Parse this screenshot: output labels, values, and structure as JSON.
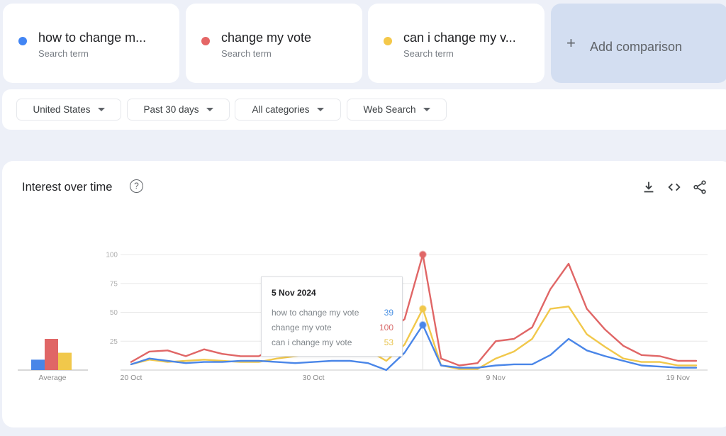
{
  "terms": [
    {
      "label": "how to change m...",
      "full": "how to change my vote",
      "sub": "Search term",
      "color": "#4285f4"
    },
    {
      "label": "change my vote",
      "full": "change my vote",
      "sub": "Search term",
      "color": "#e56666"
    },
    {
      "label": "can i change my v...",
      "full": "can i change my vote",
      "sub": "Search term",
      "color": "#f4c84a"
    }
  ],
  "add_comparison": {
    "icon": "+",
    "label": "Add comparison"
  },
  "filters": [
    {
      "label": "United States"
    },
    {
      "label": "Past 30 days"
    },
    {
      "label": "All categories"
    },
    {
      "label": "Web Search"
    }
  ],
  "panel": {
    "title": "Interest over time",
    "help_icon": "?",
    "actions": [
      "download-icon",
      "embed-code-icon",
      "share-icon"
    ]
  },
  "tooltip": {
    "date": "5 Nov 2024",
    "rows": [
      {
        "term": "how to change my vote",
        "value": "39",
        "color": "#4a90e2"
      },
      {
        "term": "change my vote",
        "value": "100",
        "color": "#d96b6b"
      },
      {
        "term": "can i change my vote",
        "value": "53",
        "color": "#e8c44e"
      }
    ]
  },
  "chart_data": {
    "type": "line",
    "title": "Interest over time",
    "x": [
      "20 Oct",
      "21 Oct",
      "22 Oct",
      "23 Oct",
      "24 Oct",
      "25 Oct",
      "26 Oct",
      "27 Oct",
      "28 Oct",
      "29 Oct",
      "30 Oct",
      "31 Oct",
      "1 Nov",
      "2 Nov",
      "3 Nov",
      "4 Nov",
      "5 Nov",
      "6 Nov",
      "7 Nov",
      "8 Nov",
      "9 Nov",
      "10 Nov",
      "11 Nov",
      "12 Nov",
      "13 Nov",
      "14 Nov",
      "15 Nov",
      "16 Nov",
      "17 Nov",
      "18 Nov",
      "19 Nov",
      "20 Nov"
    ],
    "x_tick_labels": [
      {
        "label": "20 Oct",
        "index": 0
      },
      {
        "label": "30 Oct",
        "index": 10
      },
      {
        "label": "9 Nov",
        "index": 20
      },
      {
        "label": "19 Nov",
        "index": 30
      }
    ],
    "y_ticks": [
      25,
      50,
      75,
      100
    ],
    "ylim": [
      0,
      100
    ],
    "grid": true,
    "highlight_index": 16,
    "series": [
      {
        "name": "how to change my vote",
        "color": "#4a86e8",
        "values": [
          5,
          10,
          8,
          6,
          7,
          7,
          8,
          8,
          7,
          6,
          7,
          8,
          8,
          6,
          0,
          15,
          39,
          4,
          2,
          2,
          4,
          5,
          5,
          13,
          27,
          17,
          12,
          8,
          4,
          3,
          2,
          2
        ]
      },
      {
        "name": "change my vote",
        "color": "#e06666",
        "values": [
          7,
          16,
          17,
          12,
          18,
          14,
          12,
          12,
          20,
          21,
          24,
          23,
          21,
          26,
          33,
          44,
          100,
          10,
          4,
          6,
          25,
          27,
          37,
          70,
          92,
          53,
          35,
          21,
          13,
          12,
          8,
          8
        ]
      },
      {
        "name": "can i change my vote",
        "color": "#f1c84b",
        "values": [
          5,
          9,
          7,
          8,
          9,
          8,
          7,
          7,
          10,
          12,
          14,
          15,
          16,
          17,
          8,
          22,
          53,
          4,
          1,
          1,
          10,
          16,
          27,
          53,
          55,
          31,
          20,
          10,
          7,
          7,
          4,
          4
        ]
      }
    ],
    "average": {
      "label": "Average",
      "values": [
        {
          "name": "how to change my vote",
          "value": 9
        },
        {
          "name": "change my vote",
          "value": 27
        },
        {
          "name": "can i change my vote",
          "value": 15
        }
      ]
    },
    "legend": "top"
  }
}
